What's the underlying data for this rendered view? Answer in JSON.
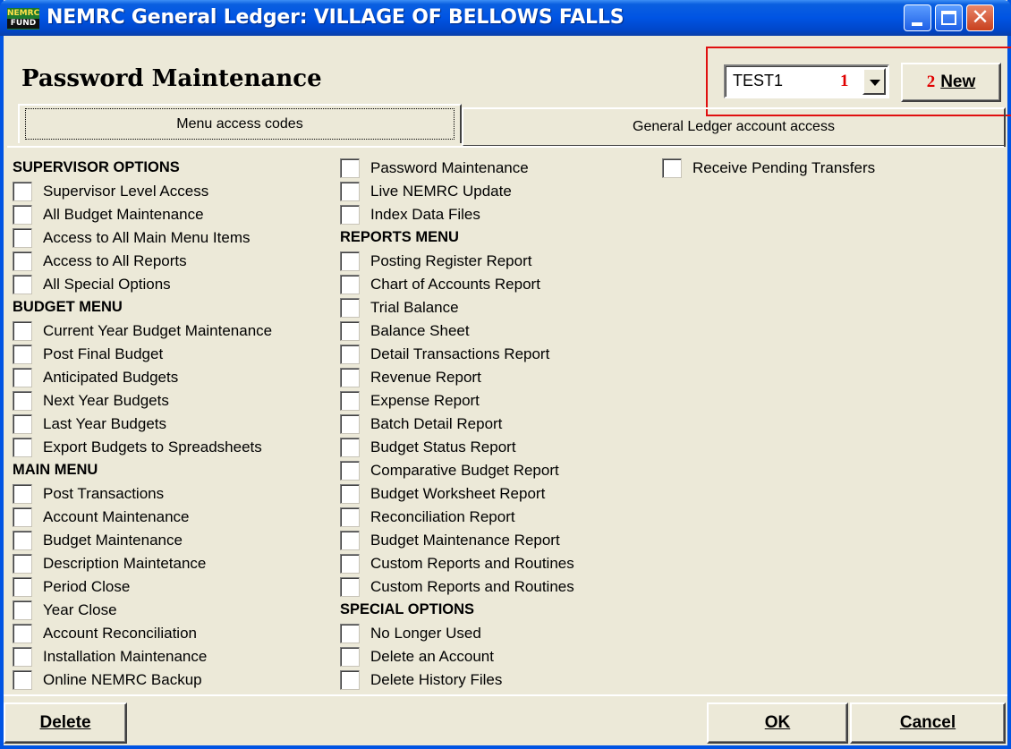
{
  "window": {
    "app_icon_top": "NEMRC",
    "app_icon_bottom": "FUND",
    "title": "NEMRC General Ledger: VILLAGE OF BELLOWS FALLS",
    "title_buttons": [
      "minimize-icon",
      "maximize-icon",
      "close-icon"
    ],
    "close_glyph": "✕"
  },
  "header": {
    "form_title": "Password Maintenance",
    "user_combo_value": "TEST1",
    "marker_1": "1",
    "marker_2": "2",
    "new_button_label": "New",
    "highlight_color": "#e01010"
  },
  "tabs": [
    {
      "label": "Menu access codes",
      "active": true
    },
    {
      "label": "General Ledger account access",
      "active": false
    }
  ],
  "columns": {
    "col1": [
      {
        "type": "header",
        "label": "SUPERVISOR OPTIONS"
      },
      {
        "type": "checkbox",
        "label": "Supervisor Level Access",
        "checked": false
      },
      {
        "type": "checkbox",
        "label": "All Budget Maintenance",
        "checked": false
      },
      {
        "type": "checkbox",
        "label": "Access to All Main Menu Items",
        "checked": false
      },
      {
        "type": "checkbox",
        "label": "Access to All Reports",
        "checked": false
      },
      {
        "type": "checkbox",
        "label": "All Special Options",
        "checked": false
      },
      {
        "type": "header",
        "label": "BUDGET MENU"
      },
      {
        "type": "checkbox",
        "label": "Current Year Budget Maintenance",
        "checked": false
      },
      {
        "type": "checkbox",
        "label": "Post Final Budget",
        "checked": false
      },
      {
        "type": "checkbox",
        "label": "Anticipated Budgets",
        "checked": false
      },
      {
        "type": "checkbox",
        "label": "Next Year Budgets",
        "checked": false
      },
      {
        "type": "checkbox",
        "label": "Last Year Budgets",
        "checked": false
      },
      {
        "type": "checkbox",
        "label": "Export Budgets to Spreadsheets",
        "checked": false
      },
      {
        "type": "header",
        "label": "MAIN MENU"
      },
      {
        "type": "checkbox",
        "label": "Post Transactions",
        "checked": false
      },
      {
        "type": "checkbox",
        "label": "Account Maintenance",
        "checked": false
      },
      {
        "type": "checkbox",
        "label": "Budget Maintenance",
        "checked": false
      },
      {
        "type": "checkbox",
        "label": "Description Maintetance",
        "checked": false
      },
      {
        "type": "checkbox",
        "label": "Period Close",
        "checked": false
      },
      {
        "type": "checkbox",
        "label": "Year Close",
        "checked": false
      },
      {
        "type": "checkbox",
        "label": "Account Reconciliation",
        "checked": false
      },
      {
        "type": "checkbox",
        "label": "Installation Maintenance",
        "checked": false
      },
      {
        "type": "checkbox",
        "label": "Online NEMRC Backup",
        "checked": false
      }
    ],
    "col2": [
      {
        "type": "checkbox",
        "label": "Password Maintenance",
        "checked": false
      },
      {
        "type": "checkbox",
        "label": "Live NEMRC Update",
        "checked": false
      },
      {
        "type": "checkbox",
        "label": "Index Data Files",
        "checked": false
      },
      {
        "type": "header",
        "label": "REPORTS MENU"
      },
      {
        "type": "checkbox",
        "label": "Posting Register Report",
        "checked": false
      },
      {
        "type": "checkbox",
        "label": "Chart of Accounts Report",
        "checked": false
      },
      {
        "type": "checkbox",
        "label": "Trial Balance",
        "checked": false
      },
      {
        "type": "checkbox",
        "label": "Balance Sheet",
        "checked": false
      },
      {
        "type": "checkbox",
        "label": "Detail Transactions Report",
        "checked": false
      },
      {
        "type": "checkbox",
        "label": "Revenue Report",
        "checked": false
      },
      {
        "type": "checkbox",
        "label": "Expense Report",
        "checked": false
      },
      {
        "type": "checkbox",
        "label": "Batch Detail Report",
        "checked": false
      },
      {
        "type": "checkbox",
        "label": "Budget Status Report",
        "checked": false
      },
      {
        "type": "checkbox",
        "label": "Comparative Budget Report",
        "checked": false
      },
      {
        "type": "checkbox",
        "label": "Budget Worksheet Report",
        "checked": false
      },
      {
        "type": "checkbox",
        "label": "Reconciliation Report",
        "checked": false
      },
      {
        "type": "checkbox",
        "label": "Budget Maintenance Report",
        "checked": false
      },
      {
        "type": "checkbox",
        "label": "Custom Reports and Routines",
        "checked": false
      },
      {
        "type": "checkbox",
        "label": "Custom Reports and Routines",
        "checked": false
      },
      {
        "type": "header",
        "label": "SPECIAL OPTIONS"
      },
      {
        "type": "checkbox",
        "label": "No Longer Used",
        "checked": false
      },
      {
        "type": "checkbox",
        "label": "Delete an Account",
        "checked": false
      },
      {
        "type": "checkbox",
        "label": "Delete History Files",
        "checked": false
      }
    ],
    "col3": [
      {
        "type": "checkbox",
        "label": "Receive Pending Transfers",
        "checked": false
      }
    ]
  },
  "footer": {
    "delete_label": "Delete",
    "ok_label": "OK",
    "cancel_label": "Cancel"
  }
}
